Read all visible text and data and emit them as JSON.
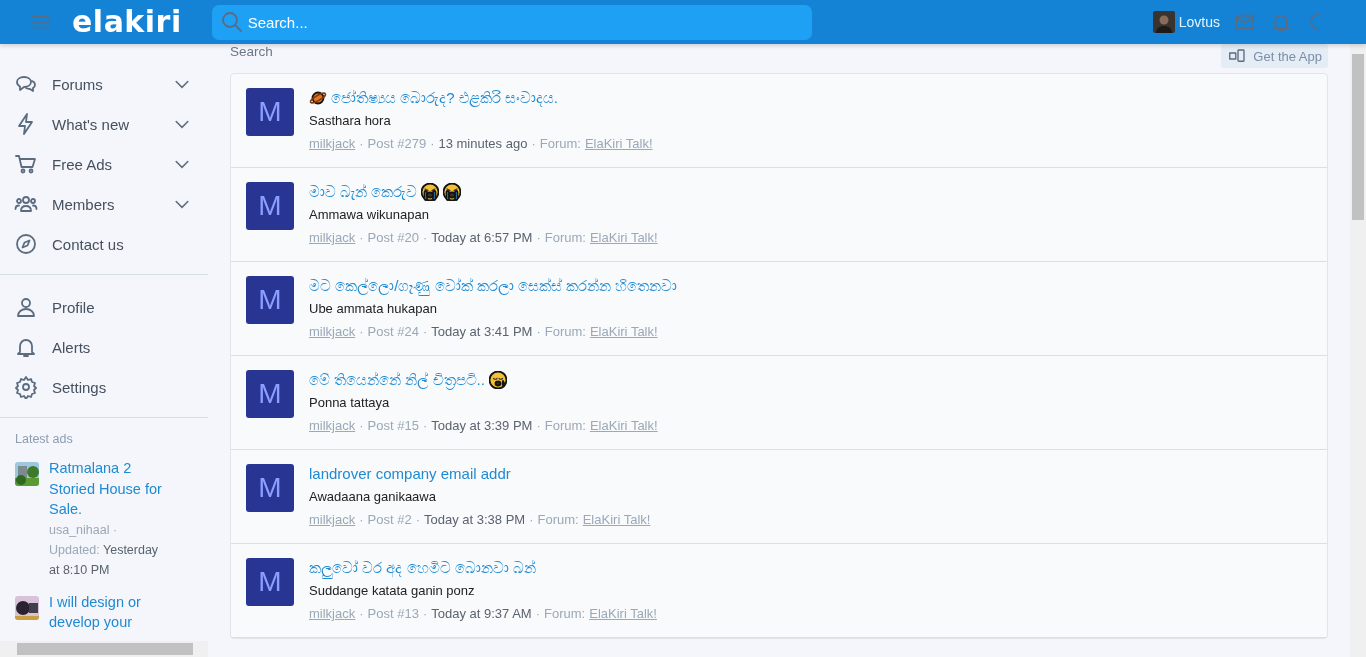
{
  "header": {
    "logo": "elakiri",
    "search_placeholder": "Search...",
    "username": "Lovtus"
  },
  "breadcrumb": "Search",
  "get_app": "Get the App",
  "separator": "·",
  "sidebar": {
    "nav": [
      {
        "label": "Forums",
        "expandable": true
      },
      {
        "label": "What's new",
        "expandable": true
      },
      {
        "label": "Free Ads",
        "expandable": true
      },
      {
        "label": "Members",
        "expandable": true
      },
      {
        "label": "Contact us",
        "expandable": false
      }
    ],
    "account": [
      {
        "label": "Profile"
      },
      {
        "label": "Alerts"
      },
      {
        "label": "Settings"
      }
    ],
    "latest_ads_title": "Latest ads",
    "ads": [
      {
        "title": "Ratmalana 2 Storied House for Sale.",
        "author": "usa_nihaal",
        "updated_label": "Updated:",
        "updated": "Yesterday at 8:10 PM"
      },
      {
        "title": "I will design or develop your"
      }
    ]
  },
  "results": [
    {
      "avatar": "M",
      "title": "ජෝතිෂ්‍යය බොරුද? එළකිරි සංවාදය.",
      "snippet": "Sasthara hora",
      "author": "milkjack",
      "post": "Post #279",
      "time": "13 minutes ago",
      "forum_label": "Forum:",
      "forum": "ElaKiri Talk!"
    },
    {
      "avatar": "M",
      "title": "මාව බැන් කෙරුව",
      "snippet": "Ammawa wikunapan",
      "author": "milkjack",
      "post": "Post #20",
      "time": "Today at 6:57 PM",
      "forum_label": "Forum:",
      "forum": "ElaKiri Talk!"
    },
    {
      "avatar": "M",
      "title": "මට කෙල්ලො/ගෑණු වෝක් කරලා සෙක්ස් කරන්න හිතෙනවා",
      "snippet": "Ube ammata hukapan",
      "author": "milkjack",
      "post": "Post #24",
      "time": "Today at 3:41 PM",
      "forum_label": "Forum:",
      "forum": "ElaKiri Talk!"
    },
    {
      "avatar": "M",
      "title": "මේ තියෙන්නේ නිල් චිත්‍රපටි..",
      "snippet": "Ponna tattaya",
      "author": "milkjack",
      "post": "Post #15",
      "time": "Today at 3:39 PM",
      "forum_label": "Forum:",
      "forum": "ElaKiri Talk!"
    },
    {
      "avatar": "M",
      "title": "landrover company email addr",
      "snippet": "Awadaana ganikaawa",
      "author": "milkjack",
      "post": "Post #2",
      "time": "Today at 3:38 PM",
      "forum_label": "Forum:",
      "forum": "ElaKiri Talk!"
    },
    {
      "avatar": "M",
      "title": "කලුවෝ වර අද හෙමිට බොනවා බන්",
      "snippet": "Suddange katata ganin ponz",
      "author": "milkjack",
      "post": "Post #13",
      "time": "Today at 9:37 AM",
      "forum_label": "Forum:",
      "forum": "ElaKiri Talk!"
    }
  ]
}
